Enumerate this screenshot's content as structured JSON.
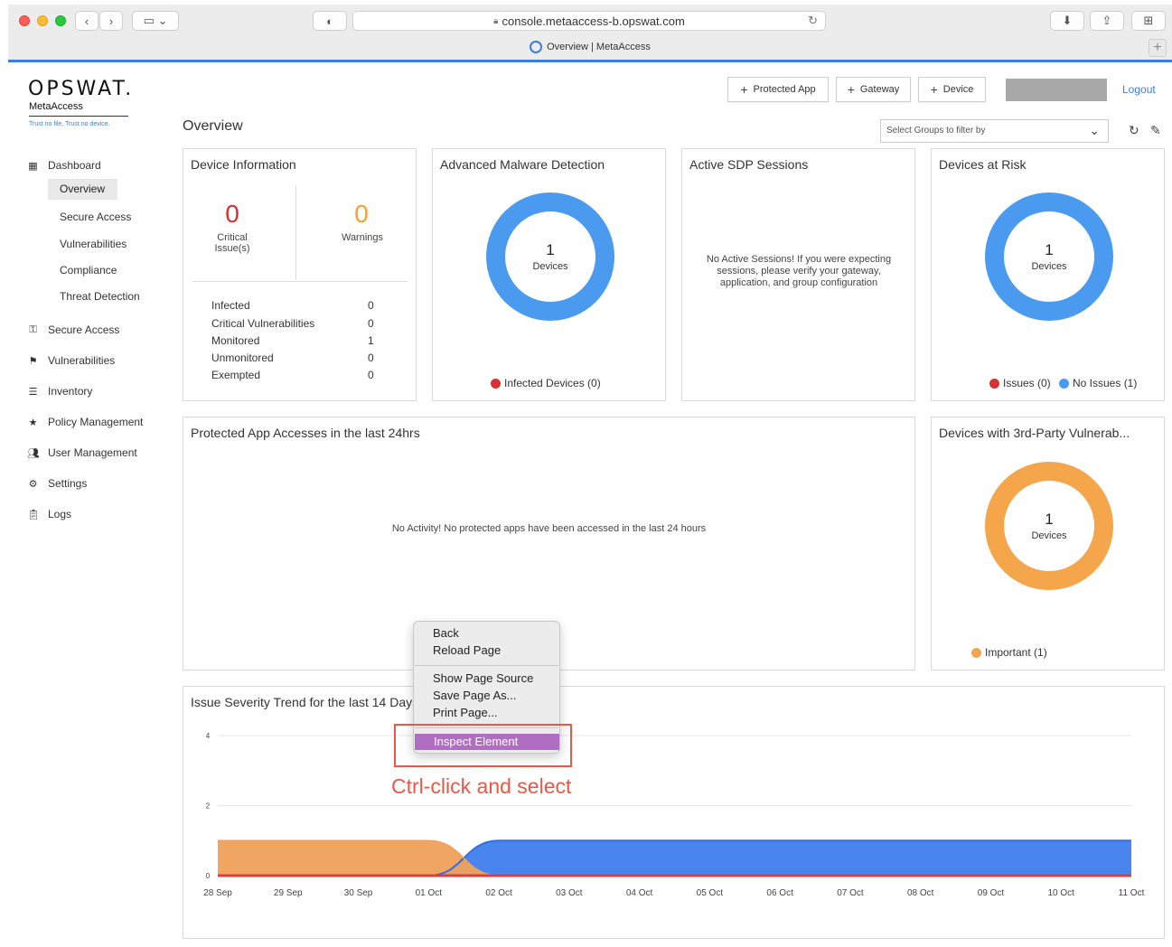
{
  "browser": {
    "url": "console.metaaccess-b.opswat.com",
    "tab_title": "Overview | MetaAccess",
    "new_tab": "+"
  },
  "brand": {
    "logo": "OPSWAT.",
    "product": "MetaAccess",
    "tagline": "Trust no file. Trust no device."
  },
  "header": {
    "buttons": [
      "Protected App",
      "Gateway",
      "Device"
    ],
    "logout": "Logout",
    "page_title": "Overview",
    "group_filter_placeholder": "Select Groups to filter by"
  },
  "sidebar": {
    "dashboard": "Dashboard",
    "dashboard_items": [
      "Overview",
      "Secure Access",
      "Vulnerabilities",
      "Compliance",
      "Threat Detection"
    ],
    "items": [
      {
        "label": "Secure Access",
        "icon": "key-icon"
      },
      {
        "label": "Vulnerabilities",
        "icon": "flag-icon"
      },
      {
        "label": "Inventory",
        "icon": "list-icon"
      },
      {
        "label": "Policy Management",
        "icon": "star-icon"
      },
      {
        "label": "User Management",
        "icon": "users-icon"
      },
      {
        "label": "Settings",
        "icon": "gear-icon"
      },
      {
        "label": "Logs",
        "icon": "clipboard-icon"
      }
    ]
  },
  "device_info": {
    "title": "Device Information",
    "critical_value": "0",
    "critical_label": "Critical Issue(s)",
    "warnings_value": "0",
    "warnings_label": "Warnings",
    "rows": [
      {
        "label": "Infected",
        "value": "0"
      },
      {
        "label": "Critical Vulnerabilities",
        "value": "0"
      },
      {
        "label": "Monitored",
        "value": "1"
      },
      {
        "label": "Unmonitored",
        "value": "0"
      },
      {
        "label": "Exempted",
        "value": "0"
      }
    ]
  },
  "malware": {
    "title": "Advanced Malware Detection",
    "count": "1",
    "unit": "Devices",
    "legend": "Infected Devices (0)"
  },
  "sdp": {
    "title": "Active SDP Sessions",
    "message": "No Active Sessions! If you were expecting sessions, please verify your gateway, application, and group configuration"
  },
  "risk": {
    "title": "Devices at Risk",
    "count": "1",
    "unit": "Devices",
    "legend_issues": "Issues (0)",
    "legend_no_issues": "No Issues (1)"
  },
  "app_access": {
    "title": "Protected App Accesses in the last 24hrs",
    "message": "No Activity! No protected apps have been accessed in the last 24 hours"
  },
  "vuln3p": {
    "title": "Devices with 3rd-Party Vulnerab...",
    "count": "1",
    "unit": "Devices",
    "legend": "Important (1)"
  },
  "trend": {
    "title": "Issue Severity Trend for the last 14 Days"
  },
  "context_menu": {
    "items_group1": [
      "Back",
      "Reload Page"
    ],
    "items_group2": [
      "Show Page Source",
      "Save Page As...",
      "Print Page..."
    ],
    "highlighted": "Inspect Element"
  },
  "annotation": "Ctrl-click and select",
  "colors": {
    "blue": "#4a9bf0",
    "orange": "#f5a54a",
    "red": "#d93030",
    "critical": "#d93030",
    "warning": "#f5a032",
    "highlight": "#b06ec3",
    "annotation": "#e6584a"
  },
  "chart_data": {
    "type": "area",
    "title": "Issue Severity Trend for the last 14 Days",
    "x": [
      "28 Sep",
      "29 Sep",
      "30 Sep",
      "01 Oct",
      "02 Oct",
      "03 Oct",
      "04 Oct",
      "05 Oct",
      "06 Oct",
      "07 Oct",
      "08 Oct",
      "09 Oct",
      "10 Oct",
      "11 Oct"
    ],
    "yticks": [
      0,
      2,
      4
    ],
    "ylim": [
      0,
      4
    ],
    "series": [
      {
        "color": "#f0a05a",
        "values": [
          1,
          1,
          1,
          1,
          0,
          0,
          0,
          0,
          0,
          0,
          0,
          0,
          0,
          0
        ]
      },
      {
        "color": "#4a84ef",
        "values": [
          0,
          0,
          0,
          0,
          1,
          1,
          1,
          1,
          1,
          1,
          1,
          1,
          1,
          1
        ]
      },
      {
        "color": "#e03b3b",
        "values": [
          0,
          0,
          0,
          0,
          0,
          0,
          0,
          0,
          0,
          0,
          0,
          0,
          0,
          0
        ]
      }
    ],
    "grid": true
  }
}
